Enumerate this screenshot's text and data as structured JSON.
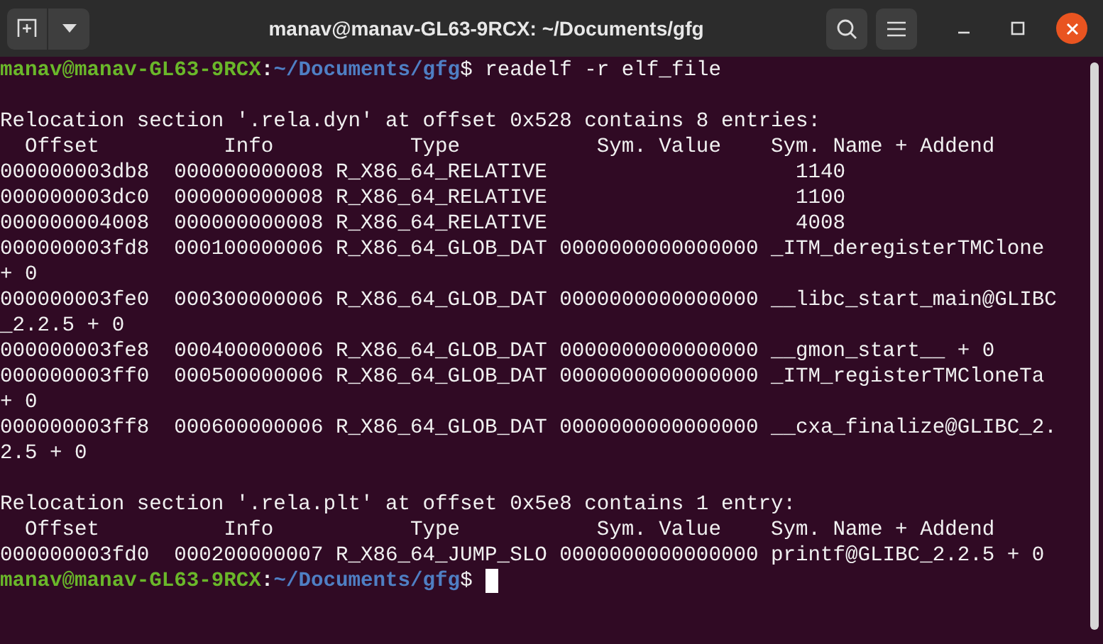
{
  "window": {
    "title": "manav@manav-GL63-9RCX: ~/Documents/gfg"
  },
  "terminal": {
    "lines": [
      {
        "kind": "prompt",
        "user_host": "manav@manav-GL63-9RCX",
        "separator": ":",
        "path": "~/Documents/gfg",
        "symbol": "$",
        "command": "readelf -r elf_file"
      },
      {
        "kind": "blank"
      },
      {
        "kind": "text",
        "text": "Relocation section '.rela.dyn' at offset 0x528 contains 8 entries:"
      },
      {
        "kind": "text",
        "text": "  Offset          Info           Type           Sym. Value    Sym. Name + Addend"
      },
      {
        "kind": "text",
        "text": "000000003db8  000000000008 R_X86_64_RELATIVE                    1140"
      },
      {
        "kind": "text",
        "text": "000000003dc0  000000000008 R_X86_64_RELATIVE                    1100"
      },
      {
        "kind": "text",
        "text": "000000004008  000000000008 R_X86_64_RELATIVE                    4008"
      },
      {
        "kind": "text",
        "text": "000000003fd8  000100000006 R_X86_64_GLOB_DAT 0000000000000000 _ITM_deregisterTMClone"
      },
      {
        "kind": "text",
        "text": "+ 0"
      },
      {
        "kind": "text",
        "text": "000000003fe0  000300000006 R_X86_64_GLOB_DAT 0000000000000000 __libc_start_main@GLIBC"
      },
      {
        "kind": "text",
        "text": "_2.2.5 + 0"
      },
      {
        "kind": "text",
        "text": "000000003fe8  000400000006 R_X86_64_GLOB_DAT 0000000000000000 __gmon_start__ + 0"
      },
      {
        "kind": "text",
        "text": "000000003ff0  000500000006 R_X86_64_GLOB_DAT 0000000000000000 _ITM_registerTMCloneTa"
      },
      {
        "kind": "text",
        "text": "+ 0"
      },
      {
        "kind": "text",
        "text": "000000003ff8  000600000006 R_X86_64_GLOB_DAT 0000000000000000 __cxa_finalize@GLIBC_2."
      },
      {
        "kind": "text",
        "text": "2.5 + 0"
      },
      {
        "kind": "blank"
      },
      {
        "kind": "text",
        "text": "Relocation section '.rela.plt' at offset 0x5e8 contains 1 entry:"
      },
      {
        "kind": "text",
        "text": "  Offset          Info           Type           Sym. Value    Sym. Name + Addend"
      },
      {
        "kind": "text",
        "text": "000000003fd0  000200000007 R_X86_64_JUMP_SLO 0000000000000000 printf@GLIBC_2.2.5 + 0"
      },
      {
        "kind": "prompt",
        "user_host": "manav@manav-GL63-9RCX",
        "separator": ":",
        "path": "~/Documents/gfg",
        "symbol": "$",
        "cursor": true
      }
    ]
  }
}
